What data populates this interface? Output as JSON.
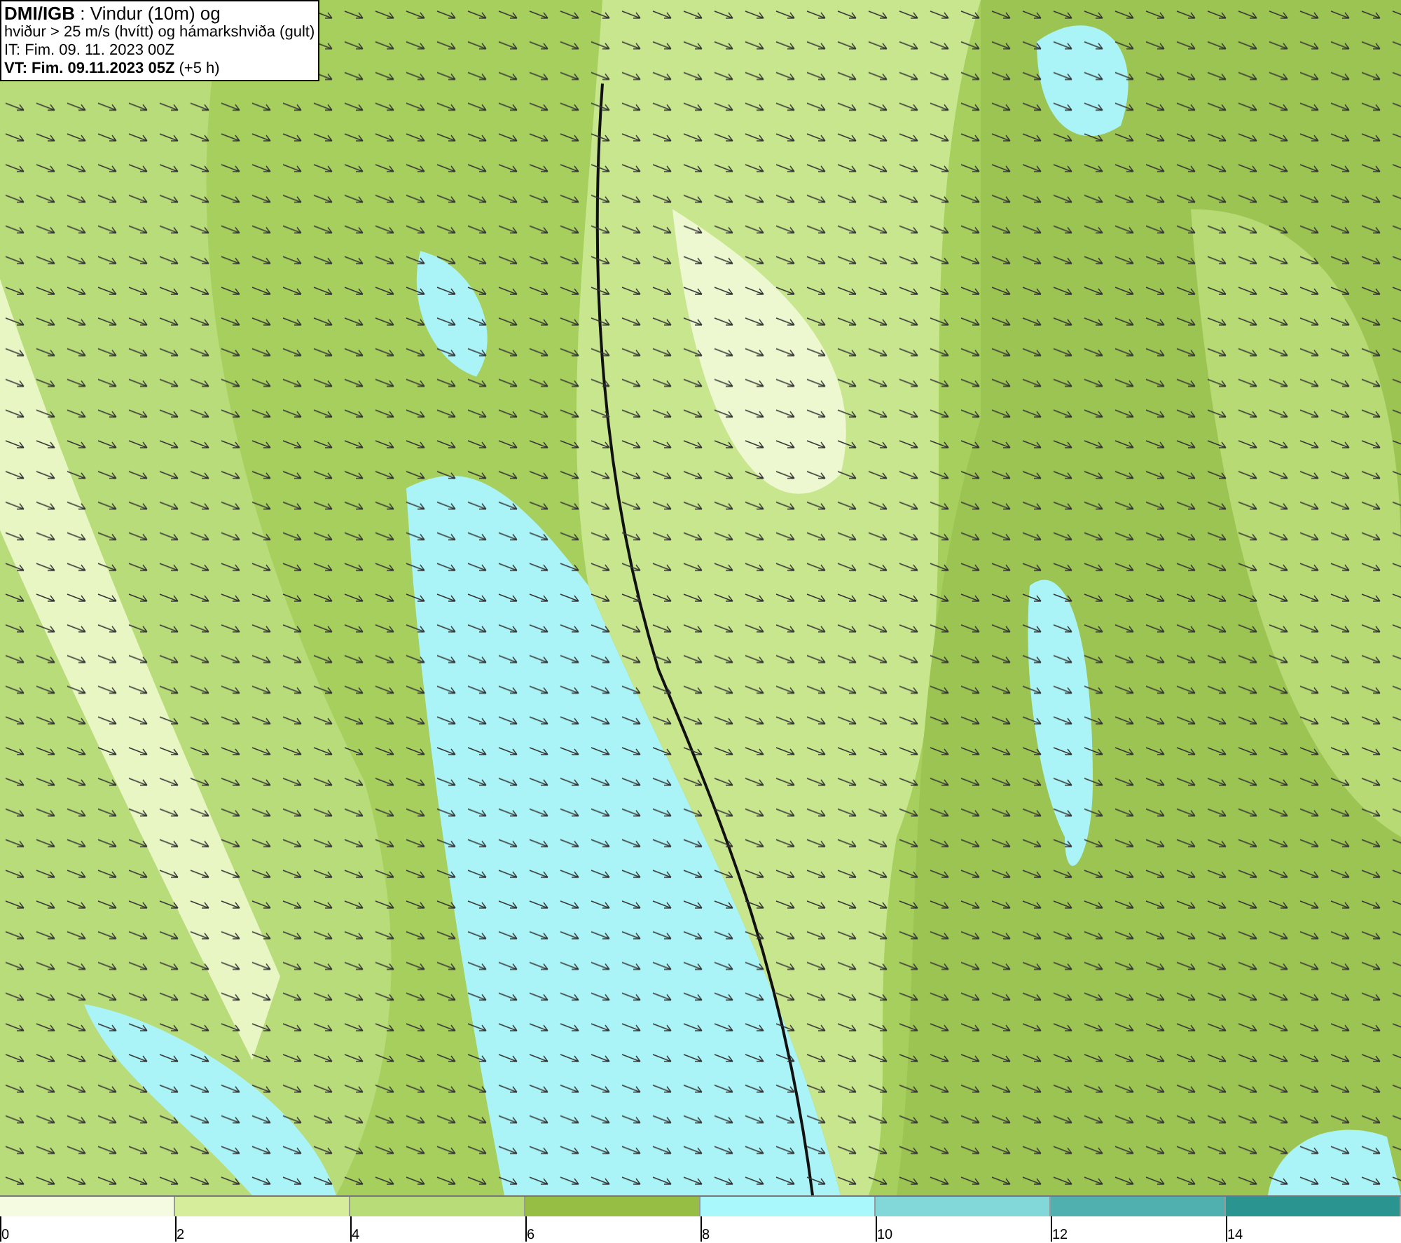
{
  "title_box": {
    "lines": [
      "**DMI/IGB** : Vindur (10m) og",
      "hviður > 25 m/s (hvítt) og hámarkshviða (gult)",
      "IT: Fim. 09. 11. 2023 00Z",
      "**VT: Fim. 09.11.2023 05Z** (+5 h)"
    ]
  },
  "legend": {
    "bins": [
      {
        "label": "0",
        "color": "#f5fbe0"
      },
      {
        "label": "2",
        "color": "#d6ee9c"
      },
      {
        "label": "4",
        "color": "#b8dc78"
      },
      {
        "label": "6",
        "color": "#96be45"
      },
      {
        "label": "8",
        "color": "#a8f8fc"
      },
      {
        "label": "10",
        "color": "#82d8d8"
      },
      {
        "label": "12",
        "color": "#50b0b0"
      },
      {
        "label": "14",
        "color": "#2a9490"
      }
    ]
  }
}
